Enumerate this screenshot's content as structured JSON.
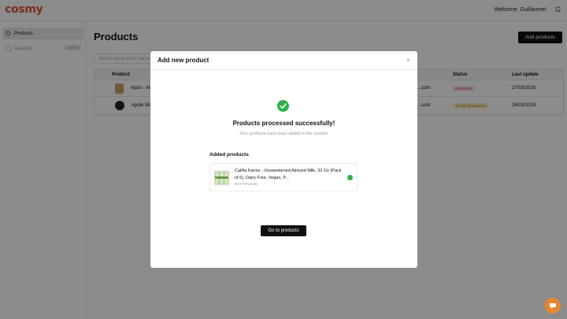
{
  "app": {
    "logo": "cosmy",
    "welcome": "Welcome, Guillaume!",
    "user_initial": "G"
  },
  "sidebar": {
    "items": [
      {
        "label": "Products",
        "icon": "tag-icon",
        "active": true
      },
      {
        "label": "Catalogs",
        "icon": "catalog-icon",
        "badge": "SOON"
      }
    ]
  },
  "page": {
    "title": "Products",
    "add_button": "Add products",
    "search_placeholder": "Search by product name"
  },
  "table": {
    "columns": [
      "Product",
      "Status",
      "Last update"
    ],
    "rows": [
      {
        "product": "Alpro - Alm",
        "email": "...com",
        "status": "WARNING",
        "updated": "27/03/2026"
      },
      {
        "product": "Apple Watc",
        "email": "...com",
        "status": "TO BE OPTIMIZED",
        "updated": "26/03/2026"
      }
    ]
  },
  "modal": {
    "title": "Add new product",
    "close": "×",
    "success_title": "Products processed successfully!",
    "success_subtitle": "Your products have been added to the system.",
    "added_label": "Added products",
    "product": {
      "name": "Califia Farms - Unsweetened Almond Milk, 32 Oz (Pack of 6), Dairy Free, Vegan, P...",
      "sku": "B07F3FZ1ND"
    },
    "goto_button": "Go to products"
  },
  "colors": {
    "brand": "#e0523a",
    "success": "#2fb24c",
    "chat": "#e8852e"
  }
}
